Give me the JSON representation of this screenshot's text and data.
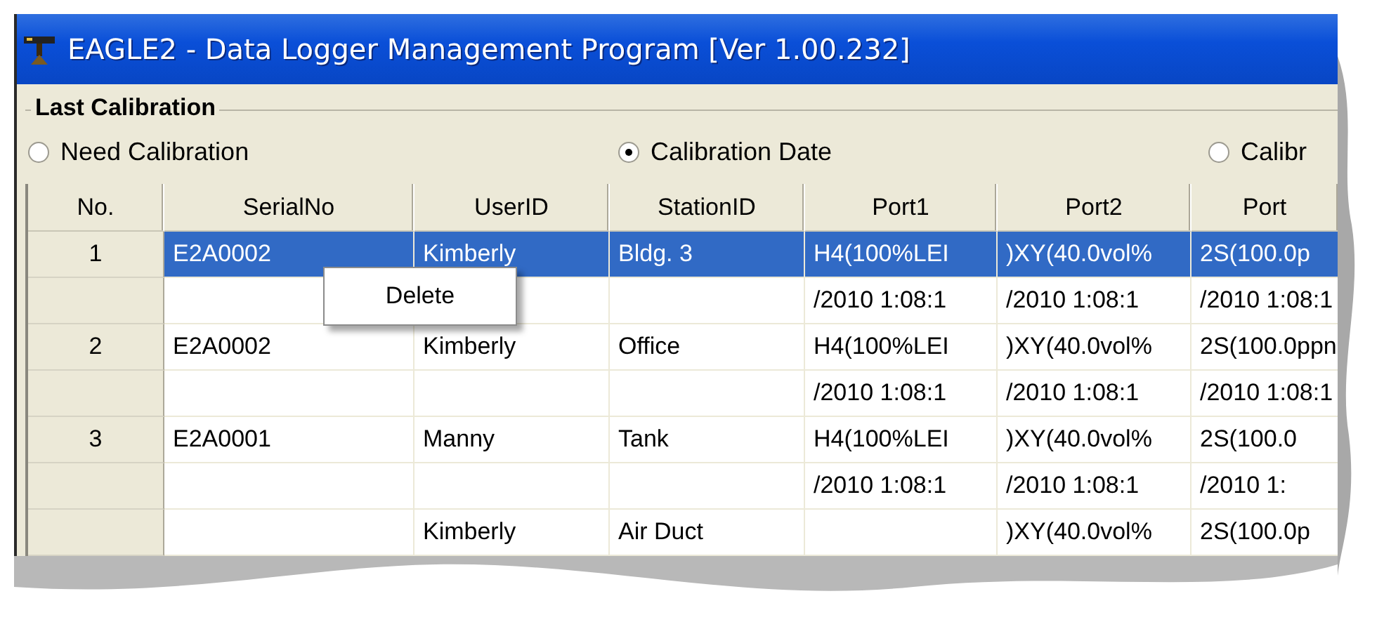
{
  "window": {
    "title": "EAGLE2  - Data Logger Management Program [Ver 1.00.232]"
  },
  "group": {
    "title": "Last Calibration"
  },
  "radios": [
    {
      "label": "Need Calibration",
      "selected": false
    },
    {
      "label": "Calibration Date",
      "selected": true
    },
    {
      "label": "Calibr",
      "selected": false
    }
  ],
  "table": {
    "columns": [
      "No.",
      "SerialNo",
      "UserID",
      "StationID",
      "Port1",
      "Port2",
      "Port"
    ],
    "rows": [
      {
        "no": "1",
        "serial_no": "E2A0002",
        "user_id": "Kimberly",
        "station_id": "Bldg. 3",
        "ports": [
          "H4(100%LEI",
          ")XY(40.0vol%",
          "2S(100.0p"
        ],
        "dates": [
          "/2010 1:08:1",
          "/2010 1:08:1",
          "/2010 1:08:1"
        ],
        "selected": true
      },
      {
        "no": "2",
        "serial_no": "E2A0002",
        "user_id": "Kimberly",
        "station_id": "Office",
        "ports": [
          "H4(100%LEI",
          ")XY(40.0vol%",
          "2S(100.0ppn"
        ],
        "dates": [
          "/2010 1:08:1",
          "/2010 1:08:1",
          "/2010 1:08:1"
        ],
        "selected": false
      },
      {
        "no": "3",
        "serial_no": "E2A0001",
        "user_id": "Manny",
        "station_id": "Tank",
        "ports": [
          "H4(100%LEI",
          ")XY(40.0vol%",
          "2S(100.0"
        ],
        "dates": [
          "/2010 1:08:1",
          "/2010 1:08:1",
          "/2010 1:"
        ],
        "selected": false
      },
      {
        "user_id": "Kimberly",
        "station_id": "Air Duct",
        "ports_from_port2": [
          ")XY(40.0vol%",
          "2S(100.0p"
        ],
        "selected": false
      }
    ]
  },
  "context_menu": {
    "items": [
      "Delete"
    ]
  }
}
